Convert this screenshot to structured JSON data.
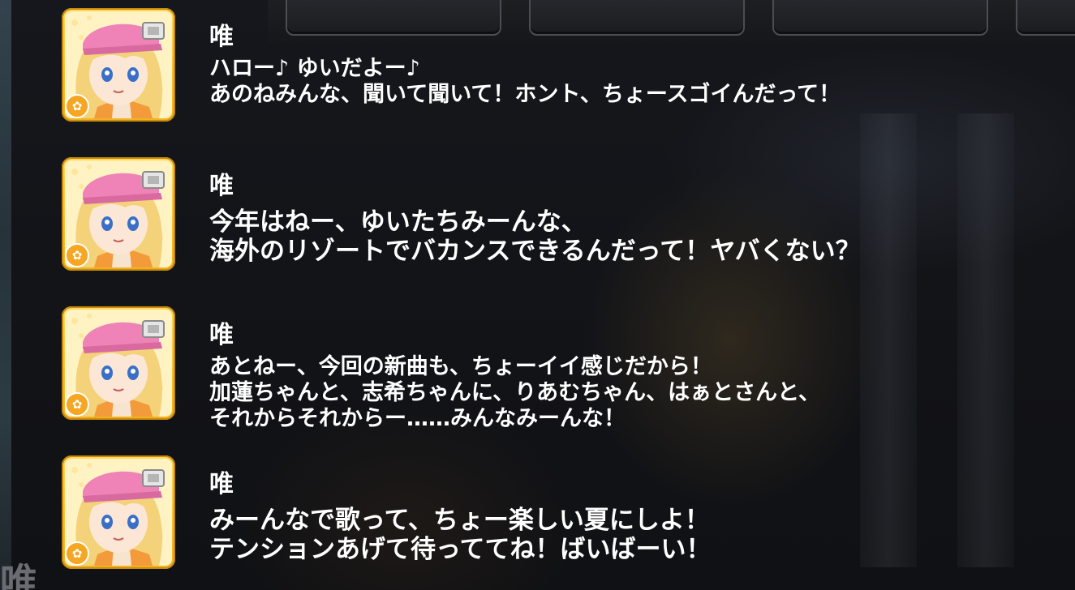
{
  "messages": [
    {
      "speaker": "唯",
      "size": "sm",
      "lines": [
        "ハロー♪ ゆいだよー♪",
        "あのねみんな、聞いて聞いて！ホント、ちょースゴイんだって！"
      ]
    },
    {
      "speaker": "唯",
      "size": "lg",
      "lines": [
        "今年はねー、ゆいたちみーんな、",
        "海外のリゾートでバカンスできるんだって！ヤバくない？"
      ]
    },
    {
      "speaker": "唯",
      "size": "sm",
      "lines": [
        "あとねー、今回の新曲も、ちょーイイ感じだから！",
        "加蓮ちゃんと、志希ちゃんに、りあむちゃん、はぁとさんと、",
        "それからそれからー……みんなみーんな！"
      ]
    },
    {
      "speaker": "唯",
      "size": "lg",
      "lines": [
        "みーんなで歌って、ちょー楽しい夏にしよ！",
        "テンションあげて待っててね！ばいばーい！"
      ]
    }
  ],
  "bottom_speaker": "唯",
  "colors": {
    "text": "#ffffff",
    "avatar_frame": "#f5c02a",
    "cap": "#ef82b6",
    "hair": "#f3d27a"
  },
  "icons": [
    "flower-badge-icon"
  ]
}
